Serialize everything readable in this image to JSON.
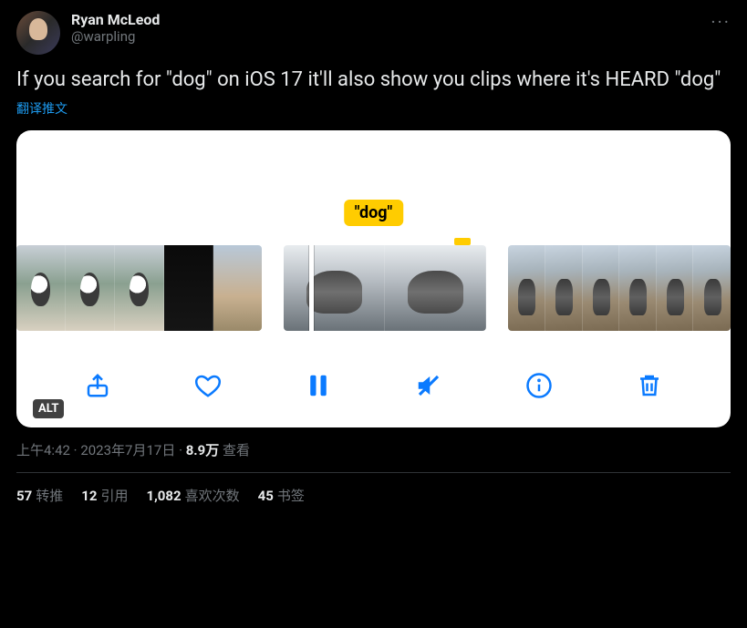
{
  "user": {
    "display_name": "Ryan McLeod",
    "handle": "@warpling"
  },
  "tweet": {
    "text": "If you search for \"dog\" on iOS 17 it'll also show you clips where it's HEARD \"dog\"",
    "translate_label": "翻译推文"
  },
  "media": {
    "caption_label": "\"dog\"",
    "alt_badge": "ALT"
  },
  "meta": {
    "time": "上午4:42",
    "date": "2023年7月17日",
    "views_count": "8.9万",
    "views_label": "查看"
  },
  "stats": {
    "retweets_count": "57",
    "retweets_label": "转推",
    "quotes_count": "12",
    "quotes_label": "引用",
    "likes_count": "1,082",
    "likes_label": "喜欢次数",
    "bookmarks_count": "45",
    "bookmarks_label": "书签"
  }
}
